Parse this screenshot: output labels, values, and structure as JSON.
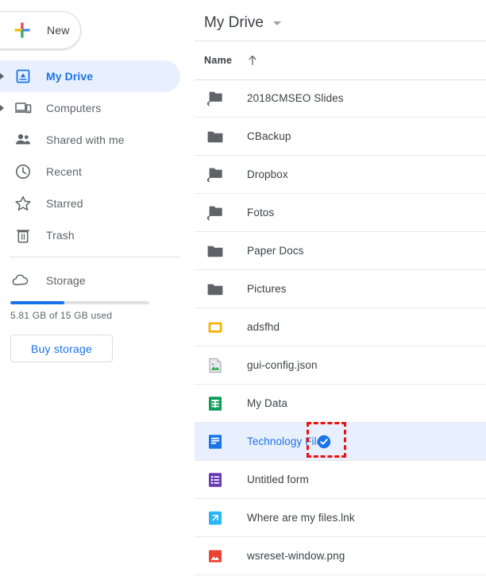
{
  "sidebar": {
    "new_button": {
      "label": "New",
      "icon": "google-plus-icon"
    },
    "items": [
      {
        "label": "My Drive",
        "icon": "drive-icon",
        "selected": true,
        "expandable": true
      },
      {
        "label": "Computers",
        "icon": "computer-icon",
        "selected": false,
        "expandable": true
      },
      {
        "label": "Shared with me",
        "icon": "people-icon",
        "selected": false,
        "expandable": false
      },
      {
        "label": "Recent",
        "icon": "clock-icon",
        "selected": false,
        "expandable": false
      },
      {
        "label": "Starred",
        "icon": "star-icon",
        "selected": false,
        "expandable": false
      },
      {
        "label": "Trash",
        "icon": "trash-icon",
        "selected": false,
        "expandable": false
      }
    ],
    "storage": {
      "label": "Storage",
      "icon": "cloud-icon",
      "usage_text": "5.81 GB of 15 GB used",
      "used_percent": 38.7,
      "buy_button_label": "Buy storage"
    }
  },
  "content": {
    "breadcrumb": {
      "label": "My Drive",
      "caret_icon": "chevron-down-icon"
    },
    "column_header": {
      "name": "Name",
      "sort_icon": "arrow-up-icon",
      "sort_direction": "ascending"
    },
    "rows": [
      {
        "name": "2018CMSEO Slides",
        "icon": "folder-shortcut-icon",
        "selected": false,
        "shared_badge": false
      },
      {
        "name": "CBackup",
        "icon": "folder-icon",
        "selected": false,
        "shared_badge": false
      },
      {
        "name": "Dropbox",
        "icon": "folder-shortcut-icon",
        "selected": false,
        "shared_badge": false
      },
      {
        "name": "Fotos",
        "icon": "folder-shortcut-icon",
        "selected": false,
        "shared_badge": false
      },
      {
        "name": "Paper Docs",
        "icon": "folder-icon",
        "selected": false,
        "shared_badge": false
      },
      {
        "name": "Pictures",
        "icon": "folder-icon",
        "selected": false,
        "shared_badge": false
      },
      {
        "name": "adsfhd",
        "icon": "amber-square-icon",
        "selected": false,
        "shared_badge": false
      },
      {
        "name": "gui-config.json",
        "icon": "image-file-icon",
        "selected": false,
        "shared_badge": false
      },
      {
        "name": "My Data",
        "icon": "sheets-icon",
        "selected": false,
        "shared_badge": false
      },
      {
        "name": "Technology File",
        "icon": "docs-icon",
        "selected": true,
        "shared_badge": true
      },
      {
        "name": "Untitled form",
        "icon": "forms-icon",
        "selected": false,
        "shared_badge": false
      },
      {
        "name": "Where are my files.lnk",
        "icon": "shortcut-file-icon",
        "selected": false,
        "shared_badge": false
      },
      {
        "name": "wsreset-window.png",
        "icon": "png-image-icon",
        "selected": false,
        "shared_badge": false
      }
    ]
  },
  "annotation": {
    "type": "red-dashed-highlight",
    "target": "shared-badge-on-technology-file"
  },
  "colors": {
    "accent_blue": "#1a73e8",
    "selected_row_bg": "#e8f0fe",
    "folder_grey": "#5f6368",
    "sheets_green": "#0f9d58",
    "forms_purple": "#673ab7",
    "amber": "#f4b400",
    "png_red": "#ea4335",
    "lnk_cyan": "#29b6f6",
    "annotation_red": "#ee1111"
  }
}
